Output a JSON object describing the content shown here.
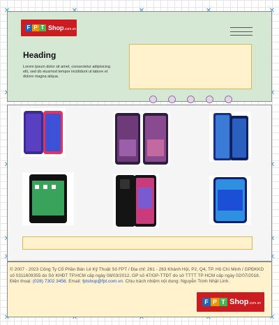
{
  "logo": {
    "letters": [
      "F",
      "P",
      "T"
    ],
    "shop": "Shop",
    "domain": ".com.vn",
    "colors": {
      "red": "#cb1c22",
      "blue": "#1f64b5",
      "green": "#4caf50",
      "orange": "#f39200"
    }
  },
  "menu": {
    "icon": "hamburger-icon"
  },
  "hero": {
    "heading": "Heading",
    "text": "Lorem ipsum dolor sit amet, consectetur adipisicing elit, sed do eiusmod tempor incididunt ut labore et dolore magna aliqua."
  },
  "carousel": {
    "dot_count": 5
  },
  "products": [
    {
      "name": "purple-blue-phone",
      "colors": [
        "#3a2d8f",
        "#e0345a"
      ]
    },
    {
      "name": "purple-dual-phone",
      "colors": [
        "#2b1f3d",
        "#6e3a7a"
      ]
    },
    {
      "name": "blue-stylus-phone",
      "colors": [
        "#1a2e80",
        "#3a7bd5"
      ]
    },
    {
      "name": "black-basic-phone",
      "colors": [
        "#111111",
        "#3aa35b"
      ]
    },
    {
      "name": "black-pink-phone",
      "colors": [
        "#141414",
        "#c93b7a"
      ]
    },
    {
      "name": "blue-wave-phone",
      "colors": [
        "#0b1e66",
        "#2f8fe0"
      ]
    }
  ],
  "footer": {
    "text": "© 2007 - 2023 Công Ty Cổ Phần Bán Lẻ Kỹ Thuật Số FPT / Địa chỉ: 261 - 263 Khánh Hội, P2, Q4, TP. Hồ Chí Minh / GPĐKKD số 0311609355 do Sở KHĐT TP.HCM cấp ngày 08/03/2012. GP số 47/GP-TTĐT do sở TTTT TP HCM cấp ngày 02/07/2018. Điện thoại:",
    "phone": "(028) 7302 3456",
    "email_label": ". Email:",
    "email": "fptshop@fpt.com.vn",
    "responsible": ". Chịu trách nhiệm nội dung: Nguyễn Trịnh Nhật Linh."
  }
}
